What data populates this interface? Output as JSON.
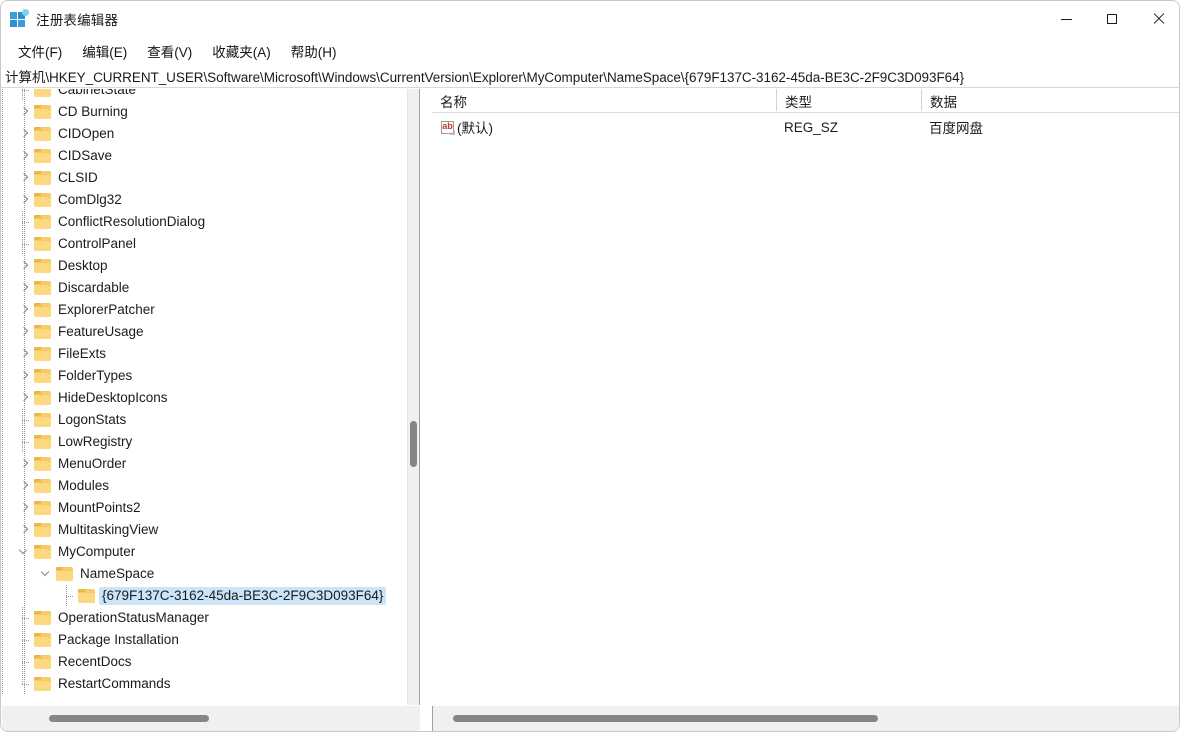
{
  "window": {
    "title": "注册表编辑器",
    "app_icon": "registry-editor-icon",
    "caption": {
      "minimize": "minimize-icon",
      "maximize": "maximize-icon",
      "close": "close-icon"
    }
  },
  "menubar": {
    "items": [
      {
        "label": "文件(F)"
      },
      {
        "label": "编辑(E)"
      },
      {
        "label": "查看(V)"
      },
      {
        "label": "收藏夹(A)"
      },
      {
        "label": "帮助(H)"
      }
    ]
  },
  "addressbar": {
    "path": "计算机\\HKEY_CURRENT_USER\\Software\\Microsoft\\Windows\\CurrentVersion\\Explorer\\MyComputer\\NameSpace\\{679F137C-3162-45da-BE3C-2F9C3D093F64}"
  },
  "tree": {
    "indent_guides": 5,
    "items": [
      {
        "label": "CabinetState",
        "depth": 5,
        "expander": "none",
        "selected": false
      },
      {
        "label": "CD Burning",
        "depth": 5,
        "expander": "collapsed",
        "selected": false
      },
      {
        "label": "CIDOpen",
        "depth": 5,
        "expander": "collapsed",
        "selected": false
      },
      {
        "label": "CIDSave",
        "depth": 5,
        "expander": "collapsed",
        "selected": false
      },
      {
        "label": "CLSID",
        "depth": 5,
        "expander": "collapsed",
        "selected": false
      },
      {
        "label": "ComDlg32",
        "depth": 5,
        "expander": "collapsed",
        "selected": false
      },
      {
        "label": "ConflictResolutionDialog",
        "depth": 5,
        "expander": "none",
        "selected": false
      },
      {
        "label": "ControlPanel",
        "depth": 5,
        "expander": "none",
        "selected": false
      },
      {
        "label": "Desktop",
        "depth": 5,
        "expander": "collapsed",
        "selected": false
      },
      {
        "label": "Discardable",
        "depth": 5,
        "expander": "collapsed",
        "selected": false
      },
      {
        "label": "ExplorerPatcher",
        "depth": 5,
        "expander": "collapsed",
        "selected": false
      },
      {
        "label": "FeatureUsage",
        "depth": 5,
        "expander": "collapsed",
        "selected": false
      },
      {
        "label": "FileExts",
        "depth": 5,
        "expander": "collapsed",
        "selected": false
      },
      {
        "label": "FolderTypes",
        "depth": 5,
        "expander": "collapsed",
        "selected": false
      },
      {
        "label": "HideDesktopIcons",
        "depth": 5,
        "expander": "collapsed",
        "selected": false
      },
      {
        "label": "LogonStats",
        "depth": 5,
        "expander": "none",
        "selected": false
      },
      {
        "label": "LowRegistry",
        "depth": 5,
        "expander": "none",
        "selected": false
      },
      {
        "label": "MenuOrder",
        "depth": 5,
        "expander": "collapsed",
        "selected": false
      },
      {
        "label": "Modules",
        "depth": 5,
        "expander": "collapsed",
        "selected": false
      },
      {
        "label": "MountPoints2",
        "depth": 5,
        "expander": "collapsed",
        "selected": false
      },
      {
        "label": "MultitaskingView",
        "depth": 5,
        "expander": "collapsed",
        "selected": false
      },
      {
        "label": "MyComputer",
        "depth": 5,
        "expander": "expanded",
        "selected": false
      },
      {
        "label": "NameSpace",
        "depth": 6,
        "expander": "expanded",
        "selected": false
      },
      {
        "label": "{679F137C-3162-45da-BE3C-2F9C3D093F64}",
        "depth": 7,
        "expander": "none",
        "selected": true
      },
      {
        "label": "OperationStatusManager",
        "depth": 5,
        "expander": "none",
        "selected": false
      },
      {
        "label": "Package Installation",
        "depth": 5,
        "expander": "none",
        "selected": false
      },
      {
        "label": "RecentDocs",
        "depth": 5,
        "expander": "none",
        "selected": false
      },
      {
        "label": "RestartCommands",
        "depth": 5,
        "expander": "none",
        "selected": false
      }
    ]
  },
  "list": {
    "columns": [
      {
        "label": "名称"
      },
      {
        "label": "类型"
      },
      {
        "label": "数据"
      }
    ],
    "rows": [
      {
        "icon": "string-value-icon",
        "name": "(默认)",
        "type": "REG_SZ",
        "data": "百度网盘"
      }
    ]
  },
  "colors": {
    "selection": "#cce4f7",
    "folder": "#fcd980",
    "scrollbar_thumb": "#868686",
    "accent": "#2f8fd0"
  }
}
